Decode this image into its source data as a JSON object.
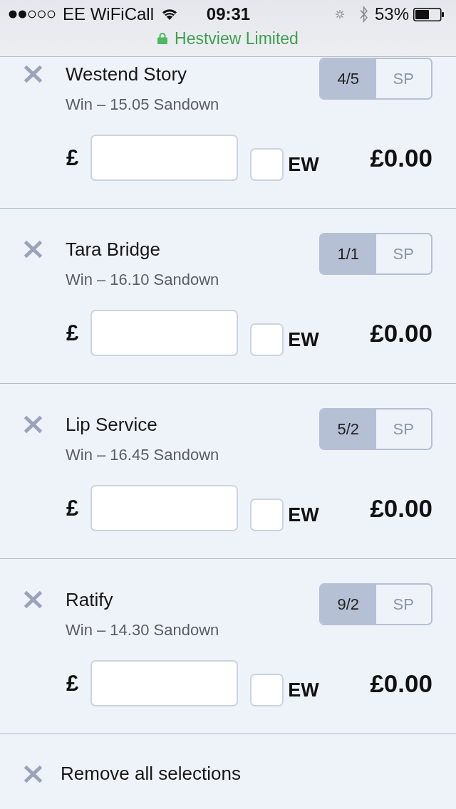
{
  "status_bar": {
    "carrier": "EE WiFiCall",
    "time": "09:31",
    "battery": "53%",
    "site": "Hestview Limited"
  },
  "selections": [
    {
      "name": "Westend Story",
      "market": "Win – 15.05 Sandown",
      "odds": [
        {
          "label": "4/5",
          "selected": true
        },
        {
          "label": "SP",
          "selected": false
        }
      ],
      "currency": "£",
      "each_way": {
        "label": "EW",
        "checked": false
      },
      "returns": "£0.00"
    },
    {
      "name": "Tara Bridge",
      "market": "Win – 16.10 Sandown",
      "odds": [
        {
          "label": "1/1",
          "selected": true
        },
        {
          "label": "SP",
          "selected": false
        }
      ],
      "currency": "£",
      "each_way": {
        "label": "EW",
        "checked": false
      },
      "returns": "£0.00"
    },
    {
      "name": "Lip Service",
      "market": "Win – 16.45 Sandown",
      "odds": [
        {
          "label": "5/2",
          "selected": true
        },
        {
          "label": "SP",
          "selected": false
        }
      ],
      "currency": "£",
      "each_way": {
        "label": "EW",
        "checked": false
      },
      "returns": "£0.00"
    },
    {
      "name": "Ratify",
      "market": "Win – 14.30 Sandown",
      "odds": [
        {
          "label": "9/2",
          "selected": true
        },
        {
          "label": "SP",
          "selected": false
        }
      ],
      "currency": "£",
      "each_way": {
        "label": "EW",
        "checked": false
      },
      "returns": "£0.00"
    }
  ],
  "remove_all": {
    "label": "Remove all selections"
  }
}
